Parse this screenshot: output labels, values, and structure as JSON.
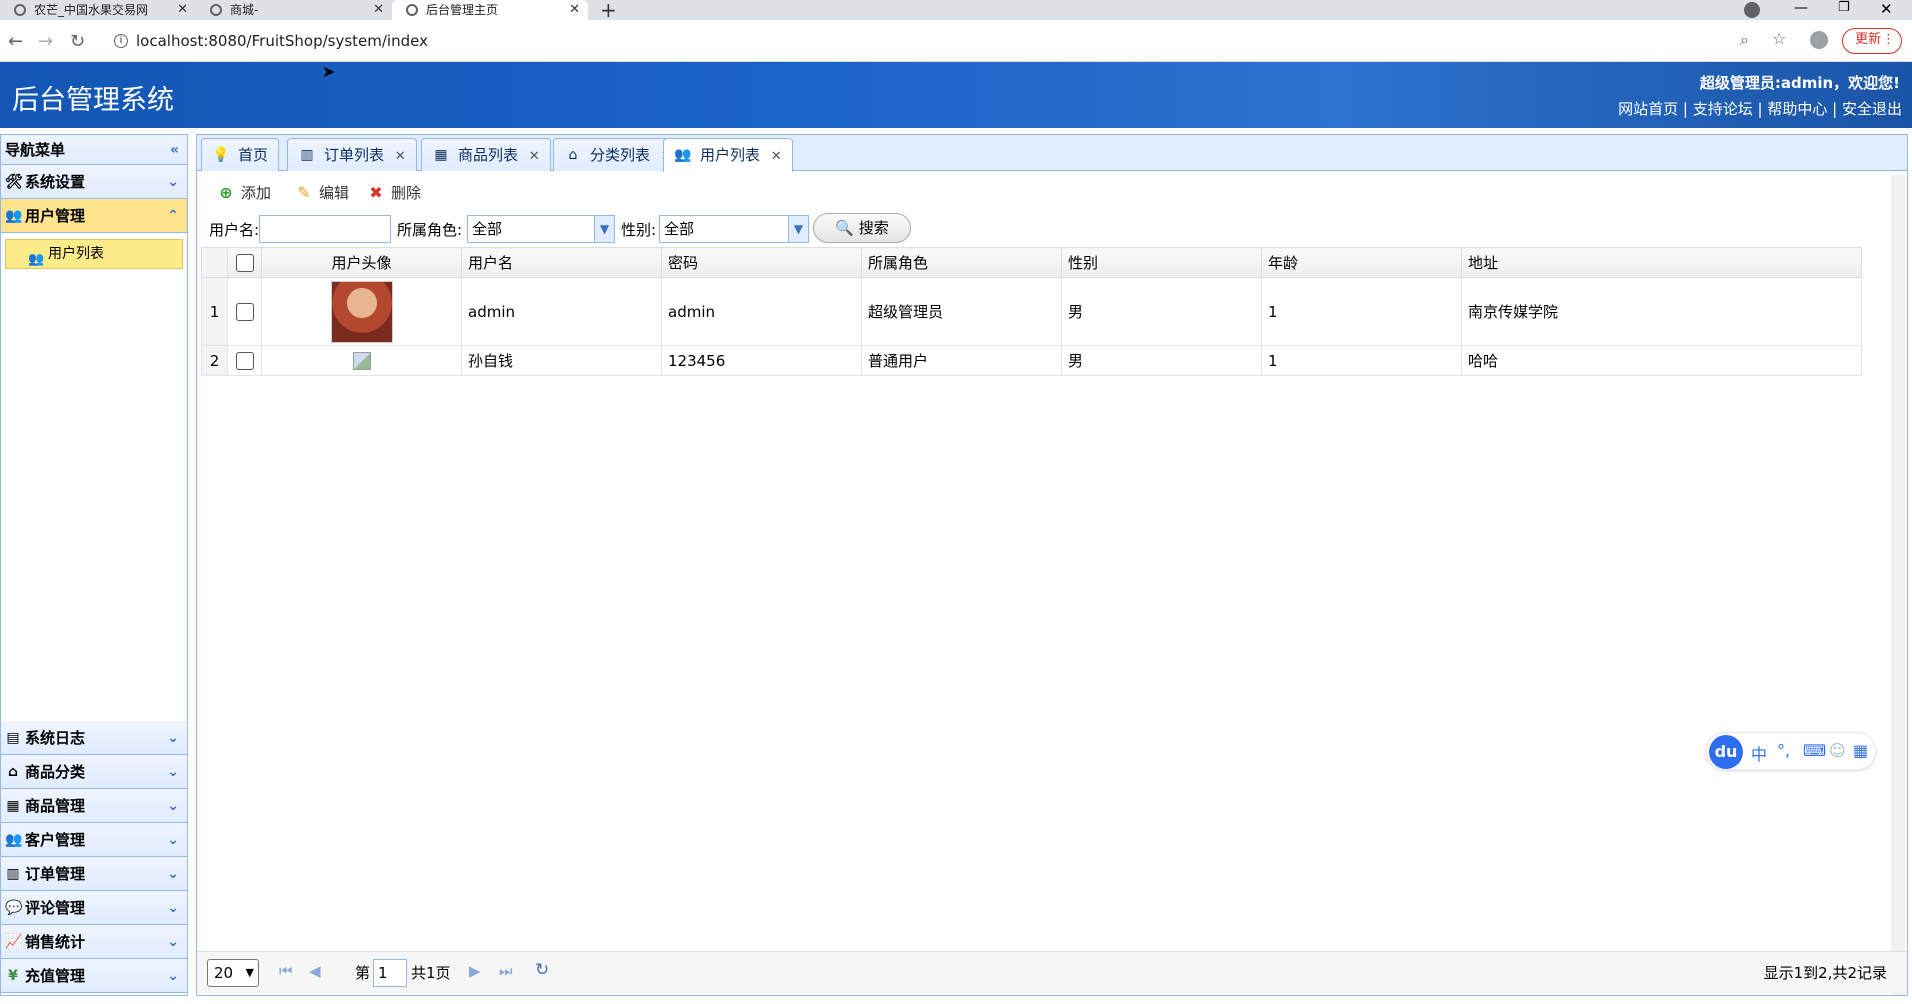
{
  "browser": {
    "tabs": [
      {
        "title": "农芒_中国水果交易网"
      },
      {
        "title": "商城-"
      },
      {
        "title": "后台管理主页"
      }
    ],
    "url": "localhost:8080/FruitShop/system/index",
    "update_label": "更新"
  },
  "header": {
    "title": "后台管理系统",
    "welcome": "超级管理员:admin，欢迎您!",
    "links": [
      "网站首页",
      "支持论坛",
      "帮助中心",
      "安全退出"
    ],
    "sep": "|"
  },
  "sidebar": {
    "title": "导航菜单",
    "top_items": [
      {
        "label": "系统设置",
        "icon": "tools-icon"
      },
      {
        "label": "用户管理",
        "icon": "users-icon"
      }
    ],
    "sub_item": "用户列表",
    "bottom_items": [
      {
        "label": "系统日志"
      },
      {
        "label": "商品分类"
      },
      {
        "label": "商品管理"
      },
      {
        "label": "客户管理"
      },
      {
        "label": "订单管理"
      },
      {
        "label": "评论管理"
      },
      {
        "label": "销售统计"
      },
      {
        "label": "充值管理"
      }
    ]
  },
  "page_tabs": [
    "首页",
    "订单列表",
    "商品列表",
    "分类列表",
    "用户列表"
  ],
  "toolbar": {
    "add": "添加",
    "edit": "编辑",
    "delete": "删除"
  },
  "filter": {
    "username_label": "用户名:",
    "username_value": "",
    "role_label": "所属角色:",
    "role_value": "全部",
    "gender_label": "性别:",
    "gender_value": "全部",
    "search_label": "搜索"
  },
  "grid": {
    "columns": [
      "用户头像",
      "用户名",
      "密码",
      "所属角色",
      "性别",
      "年龄",
      "地址"
    ],
    "rows": [
      {
        "num": "1",
        "username": "admin",
        "password": "admin",
        "role": "超级管理员",
        "gender": "男",
        "age": "1",
        "address": "南京传媒学院"
      },
      {
        "num": "2",
        "username": "孙自钱",
        "password": "123456",
        "role": "普通用户",
        "gender": "男",
        "age": "1",
        "address": "哈哈"
      }
    ]
  },
  "pager": {
    "page_size": "20",
    "page_prefix": "第",
    "page_value": "1",
    "total_pages": "共1页",
    "summary": "显示1到2,共2记录"
  },
  "ime": {
    "logo": "du",
    "mode": "中"
  }
}
